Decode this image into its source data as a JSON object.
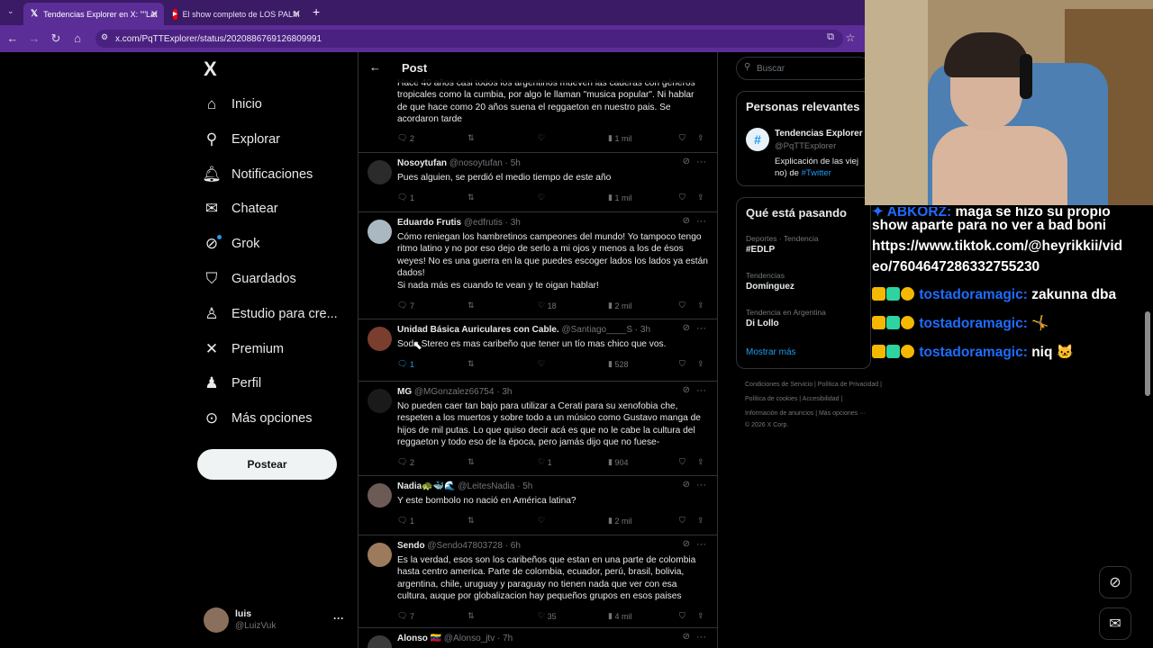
{
  "browser": {
    "tabs": [
      {
        "label": "Tendencias Explorer en X: \"\"Lat",
        "icon": "x-logo-icon",
        "active": true
      },
      {
        "label": "El show completo de LOS PALM",
        "icon": "youtube-icon",
        "active": false
      }
    ],
    "new_tab": "+",
    "url": "x.com/PqTTExplorer/status/2020886769126809991"
  },
  "nav": {
    "logo": "X",
    "items": [
      {
        "label": "Inicio",
        "icon": "home-icon"
      },
      {
        "label": "Explorar",
        "icon": "search-icon"
      },
      {
        "label": "Notificaciones",
        "icon": "bell-icon"
      },
      {
        "label": "Chatear",
        "icon": "mail-icon"
      },
      {
        "label": "Grok",
        "icon": "grok-icon"
      },
      {
        "label": "Guardados",
        "icon": "bookmark-icon"
      },
      {
        "label": "Estudio para cre...",
        "icon": "studio-icon"
      },
      {
        "label": "Premium",
        "icon": "x-premium-icon"
      },
      {
        "label": "Perfil",
        "icon": "person-icon"
      },
      {
        "label": "Más opciones",
        "icon": "more-circle-icon"
      }
    ],
    "post_button": "Postear",
    "account": {
      "name": "luis",
      "handle": "@LuizVuk",
      "more": "···"
    }
  },
  "header": {
    "title": "Post"
  },
  "tweets": [
    {
      "name": "",
      "handle": "",
      "time": "",
      "text": "Hace 40 años casi todos los argentinos mueven las caderas con géneros\ntropicales como la cumbia, por algo le llaman \"musica popular\". Ni hablar\nde que hace como 20 años suena el reggaeton en nuestro pais. Se\nacordaron tarde",
      "replies": "2",
      "reposts": "",
      "likes": "",
      "views": "1 mil"
    },
    {
      "name": "Nosoytufan",
      "handle": "@nosoytufan",
      "time": "· 5h",
      "text": "Pues alguien, se perdió el medio tiempo de este año",
      "replies": "1",
      "reposts": "",
      "likes": "",
      "views": "1 mil"
    },
    {
      "name": "Eduardo Frutis",
      "handle": "@edfrutis",
      "time": "· 3h",
      "text": "Cómo reniegan los hambretinos campeones del mundo! Yo tampoco tengo\nritmo latino y no por eso dejo de serlo a mi ojos y menos a los de ésos\nweyes! No es una guerra en la que puedes escoger lados los lados ya están\ndados!\nSi nada más es cuando te vean y te oigan hablar!",
      "replies": "7",
      "reposts": "",
      "likes": "18",
      "views": "2 mil"
    },
    {
      "name": "Unidad Básica Auriculares con Cable.",
      "handle": "@Santiago____S",
      "time": "· 3h",
      "text": "Soda Stereo es mas caribeño que tener un tío mas chico que vos.",
      "replies": "1",
      "reposts": "",
      "likes": "",
      "views": "528"
    },
    {
      "name": "MG",
      "handle": "@MGonzalez66754",
      "time": "· 3h",
      "text": "No pueden caer tan bajo para utilizar a Cerati para su xenofobia che,\nrespeten a los muertos y sobre todo a un músico como Gustavo manga de\nhijos de mil putas. Lo que quiso decir acá es que no le cabe la cultura del\nreggaeton y todo eso de la época, pero jamás dijo que no fuese-",
      "replies": "2",
      "reposts": "",
      "likes": "1",
      "views": "904"
    },
    {
      "name": "Nadia🐢🐳🌊",
      "handle": "@LeitesNadia",
      "time": "· 5h",
      "text": "Y este bombolo no nació en América latina?",
      "replies": "1",
      "reposts": "",
      "likes": "",
      "views": "2 mil"
    },
    {
      "name": "Sendo",
      "handle": "@Sendo47803728",
      "time": "· 6h",
      "text": "Es la verdad, esos son los caribeños que estan en una parte de colombia\nhasta centro america. Parte de colombia, ecuador, perú, brasil, bolivia,\nargentina, chile, uruguay y paraguay no tienen nada que ver con esa\ncultura, auque por globalizacion hay pequeños grupos en esos paises",
      "replies": "7",
      "reposts": "",
      "likes": "35",
      "views": "4 mil"
    },
    {
      "name": "Alonso 🇻🇪",
      "handle": "@Alonso_jtv",
      "time": "· 7h",
      "text": "",
      "replies": "",
      "reposts": "",
      "likes": "",
      "views": ""
    }
  ],
  "right": {
    "search_placeholder": "Buscar",
    "relevant_title": "Personas relevantes",
    "relevant_person": {
      "name": "Tendencias Explorer",
      "handle": "@PqTTExplorer",
      "bio_1": "Explicación de las viej",
      "bio_2": "no) de ",
      "bio_link": "#Twitter"
    },
    "trends_title": "Qué está pasando",
    "trends": [
      {
        "context": "Deportes · Tendencia",
        "name": "#EDLP"
      },
      {
        "context": "Tendencias",
        "name": "Domínguez"
      },
      {
        "context": "Tendencia en Argentina",
        "name": "Di Lollo"
      }
    ],
    "show_more": "Mostrar más",
    "footer": [
      "Condiciones de Servicio  |  Política de Privacidad  |",
      "Política de cookies  |  Accesibilidad  |",
      "Información de anuncios  |  Más opciones ···",
      "© 2026 X Corp."
    ]
  },
  "overlay_chat": {
    "message_lines": [
      "show aparte para no ver a bad boni",
      "https://www.tiktok.com/@heyrikkii/vid",
      "eo/7604647286332755230"
    ],
    "messages": [
      {
        "user": "tostadoramagic:",
        "text": "zakunna dba"
      },
      {
        "user": "tostadoramagic:",
        "text": "🤸"
      },
      {
        "user": "tostadoramagic:",
        "text": "niq 🐱"
      }
    ]
  },
  "colors": {
    "accent": "#1d9bf0",
    "chrome": "#5b2d96",
    "tabbar": "#3b1a66",
    "chat_user": "#1e6dff"
  }
}
